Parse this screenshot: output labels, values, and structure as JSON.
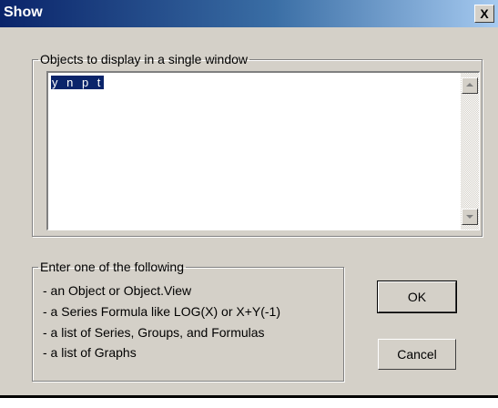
{
  "window": {
    "title": "Show",
    "close_label": "X"
  },
  "objects_group": {
    "legend": "Objects to display in a single window",
    "value": "y n p t"
  },
  "help_group": {
    "legend": "Enter one of the following",
    "lines": [
      "- an Object or Object.View",
      "- a Series Formula like LOG(X) or X+Y(-1)",
      "- a list of Series, Groups, and Formulas",
      "- a list of Graphs"
    ]
  },
  "buttons": {
    "ok": "OK",
    "cancel": "Cancel"
  },
  "colors": {
    "titlebar_start": "#0a246a",
    "titlebar_end": "#a6caf0",
    "dialog_face": "#d4d0c8",
    "selection": "#0a246a"
  }
}
